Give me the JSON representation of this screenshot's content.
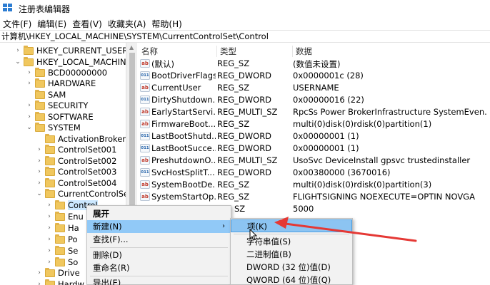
{
  "window": {
    "title": "注册表编辑器"
  },
  "menu": [
    "文件(F)",
    "编辑(E)",
    "查看(V)",
    "收藏夹(A)",
    "帮助(H)"
  ],
  "address": "计算机\\HKEY_LOCAL_MACHINE\\SYSTEM\\CurrentControlSet\\Control",
  "tree": [
    {
      "label": "HKEY_CURRENT_USER",
      "chev": "›"
    },
    {
      "label": "HKEY_LOCAL_MACHINE",
      "chev": "⌄"
    },
    {
      "label": "BCD00000000",
      "chev": "›"
    },
    {
      "label": "HARDWARE",
      "chev": "›"
    },
    {
      "label": "SAM",
      "chev": ""
    },
    {
      "label": "SECURITY",
      "chev": "›"
    },
    {
      "label": "SOFTWARE",
      "chev": "›"
    },
    {
      "label": "SYSTEM",
      "chev": "⌄"
    },
    {
      "label": "ActivationBroker",
      "chev": ""
    },
    {
      "label": "ControlSet001",
      "chev": "›"
    },
    {
      "label": "ControlSet002",
      "chev": "›"
    },
    {
      "label": "ControlSet003",
      "chev": "›"
    },
    {
      "label": "ControlSet004",
      "chev": "›"
    },
    {
      "label": "CurrentControlSet",
      "chev": "⌄"
    },
    {
      "label": "Control",
      "chev": "›"
    },
    {
      "label": "Enu",
      "chev": "›"
    },
    {
      "label": "Ha",
      "chev": "›"
    },
    {
      "label": "Po",
      "chev": "›"
    },
    {
      "label": "Se",
      "chev": "›"
    },
    {
      "label": "So",
      "chev": "›"
    },
    {
      "label": "Drive",
      "chev": "›"
    },
    {
      "label": "Hardw",
      "chev": "›"
    }
  ],
  "columns": {
    "name": "名称",
    "type": "类型",
    "data": "数据"
  },
  "rows": [
    {
      "icon": "ab",
      "name": "(默认)",
      "type": "REG_SZ",
      "data": "(数值未设置)"
    },
    {
      "icon": "bin",
      "name": "BootDriverFlags",
      "type": "REG_DWORD",
      "data": "0x0000001c (28)"
    },
    {
      "icon": "ab",
      "name": "CurrentUser",
      "type": "REG_SZ",
      "data": "USERNAME"
    },
    {
      "icon": "bin",
      "name": "DirtyShutdown...",
      "type": "REG_DWORD",
      "data": "0x00000016 (22)"
    },
    {
      "icon": "ab",
      "name": "EarlyStartServi...",
      "type": "REG_MULTI_SZ",
      "data": "RpcSs Power BrokerInfrastructure SystemEven..."
    },
    {
      "icon": "ab",
      "name": "FirmwareBoot...",
      "type": "REG_SZ",
      "data": "multi(0)disk(0)rdisk(0)partition(1)"
    },
    {
      "icon": "bin",
      "name": "LastBootShutd...",
      "type": "REG_DWORD",
      "data": "0x00000001 (1)"
    },
    {
      "icon": "bin",
      "name": "LastBootSucce...",
      "type": "REG_DWORD",
      "data": "0x00000001 (1)"
    },
    {
      "icon": "ab",
      "name": "PreshutdownO...",
      "type": "REG_MULTI_SZ",
      "data": "UsoSvc DeviceInstall gpsvc trustedinstaller"
    },
    {
      "icon": "bin",
      "name": "SvcHostSplitT...",
      "type": "REG_DWORD",
      "data": "0x00380000 (3670016)"
    },
    {
      "icon": "ab",
      "name": "SystemBootDe...",
      "type": "REG_SZ",
      "data": "multi(0)disk(0)rdisk(0)partition(3)"
    },
    {
      "icon": "ab",
      "name": "SystemStartOp...",
      "type": "REG_SZ",
      "data": " FLIGHTSIGNING  NOEXECUTE=OPTIN  NOVGA"
    },
    {
      "icon": "ab",
      "name": "",
      "type": "SZ",
      "data": "5000"
    }
  ],
  "context_menu": {
    "items": [
      "展开",
      "新建(N)",
      "查找(F)...",
      "删除(D)",
      "重命名(R)",
      "导出(E)"
    ],
    "submenu_arrow": "›"
  },
  "submenu": {
    "items": [
      "项(K)",
      "字符串值(S)",
      "二进制值(B)",
      "DWORD (32 位)值(D)",
      "QWORD (64 位)值(Q)"
    ]
  },
  "colors": {
    "highlight": "#91c9f7",
    "annotation": "#e53935",
    "folder": "#f0c75e"
  }
}
